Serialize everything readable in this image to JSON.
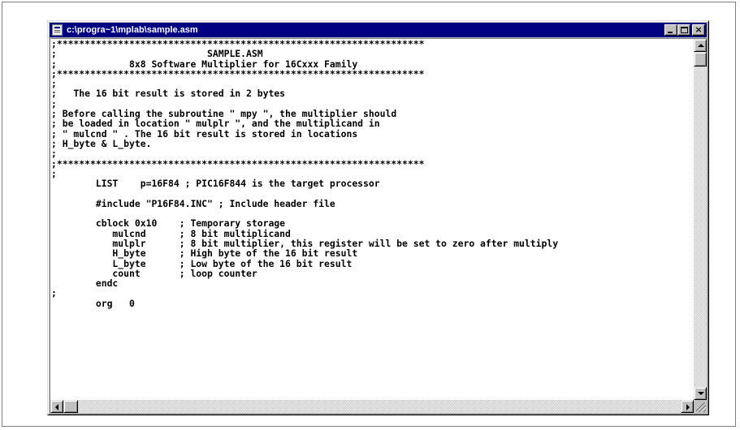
{
  "window": {
    "title": "c:\\progra~1\\mplab\\sample.asm",
    "buttons": {
      "minimize": "_",
      "maximize": "□",
      "close": "×"
    }
  },
  "code_lines": [
    ";******************************************************************",
    ";                           SAMPLE.ASM",
    ";             8x8 Software Multiplier for 16Cxxx Family",
    ";******************************************************************",
    ";",
    ";   The 16 bit result is stored in 2 bytes",
    ";",
    "; Before calling the subroutine \" mpy \", the multiplier should",
    "; be loaded in location \" mulplr \", and the multiplicand in",
    "; \" mulcnd \" . The 16 bit result is stored in locations",
    "; H_byte & L_byte.",
    ";",
    ";******************************************************************",
    ";",
    "        LIST    p=16F84 ; PIC16F844 is the target processor",
    "",
    "        #include \"P16F84.INC\" ; Include header file",
    "",
    "        cblock 0x10    ; Temporary storage",
    "           mulcnd      ; 8 bit multiplicand",
    "           mulplr      ; 8 bit multiplier, this register will be set to zero after multiply",
    "           H_byte      ; High byte of the 16 bit result",
    "           L_byte      ; Low byte of the 16 bit result",
    "           count       ; loop counter",
    "        endc",
    ";",
    "        org   0"
  ]
}
